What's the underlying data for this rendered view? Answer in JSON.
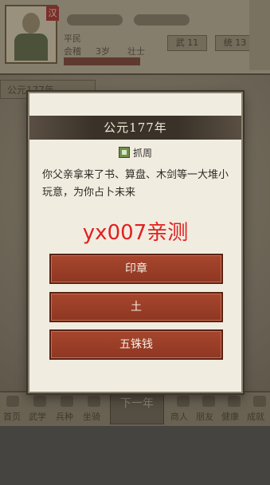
{
  "background": {
    "top_left_badge": "汉",
    "labels": [
      "平民",
      "会稽",
      "3岁",
      "壮士",
      "武",
      "11",
      "统",
      "13"
    ],
    "tab_label": "公元177年",
    "bottom_nav": [
      "首页",
      "武学",
      "兵种",
      "坐骑",
      "下一年",
      "商人",
      "朋友",
      "健康",
      "成就"
    ]
  },
  "dialog": {
    "title": "公元177年",
    "event_name": "抓周",
    "description": "你父亲拿来了书、算盘、木剑等一大堆小玩意，为你占卜未来",
    "watermark": "yx007亲测",
    "choices": [
      {
        "label": "印章"
      },
      {
        "label": "土"
      },
      {
        "label": "五铢钱"
      }
    ]
  }
}
